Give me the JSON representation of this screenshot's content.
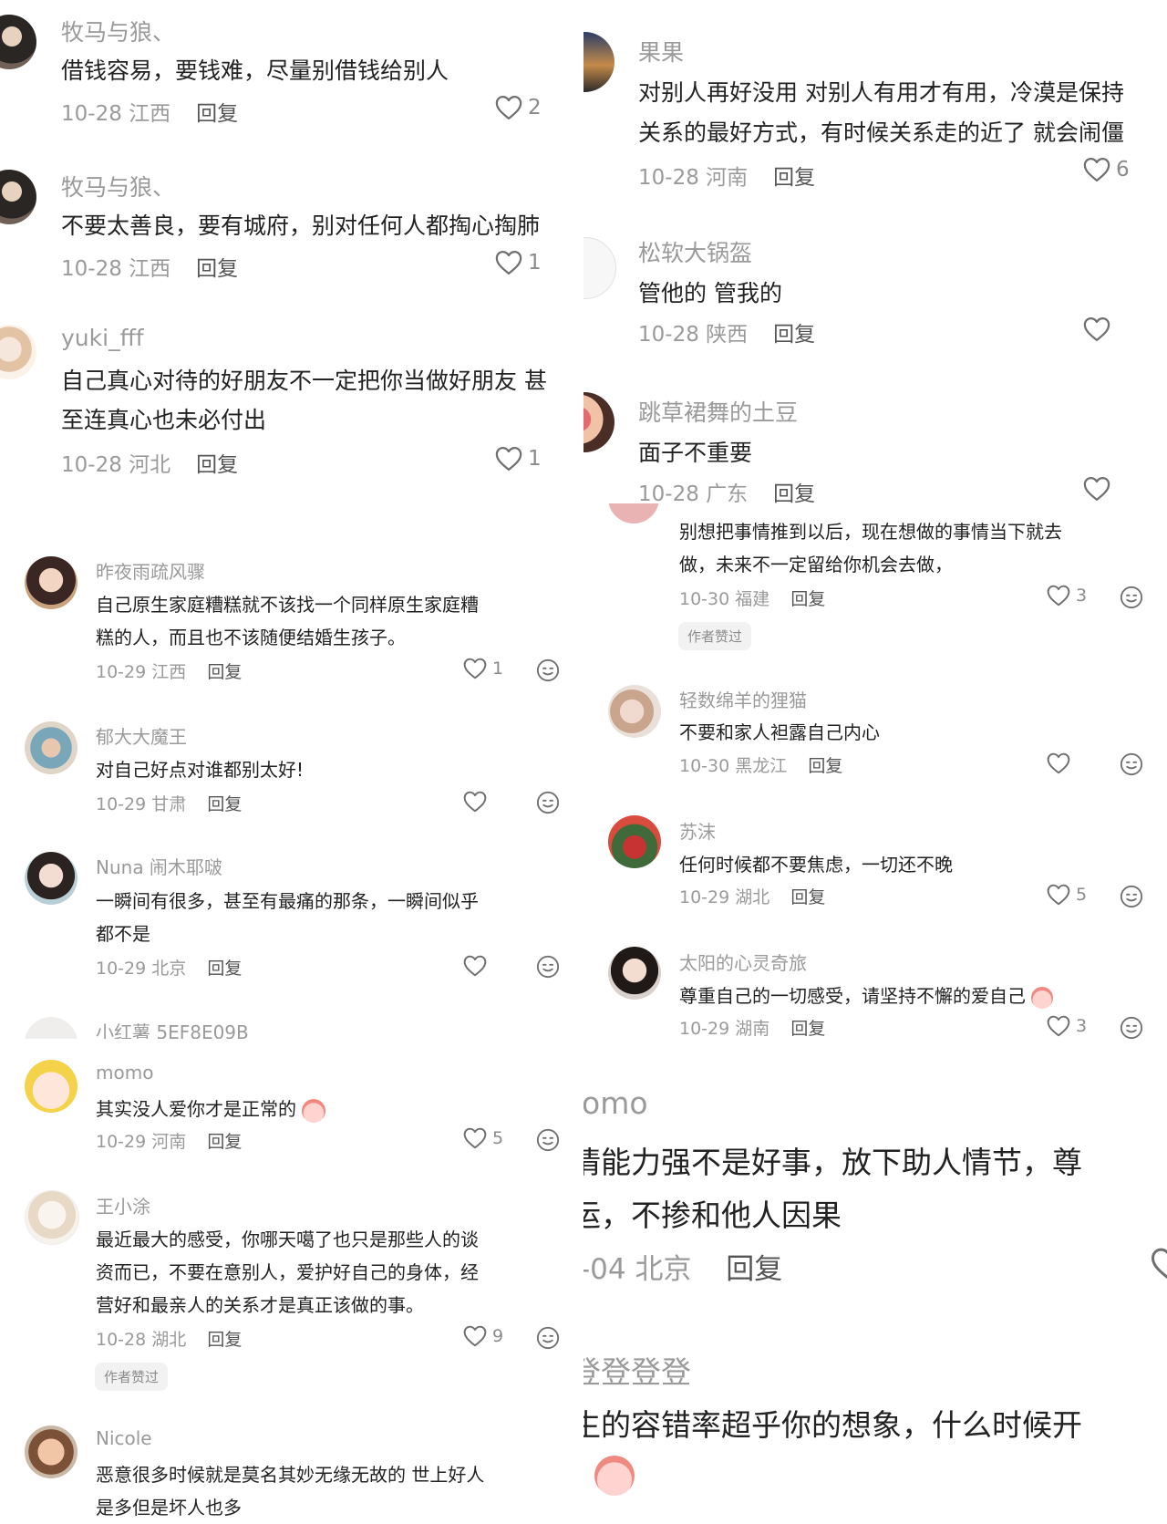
{
  "top_left": {
    "comments": [
      {
        "user": "牧马与狼、",
        "text": "借钱容易，要钱难，尽量别借钱给别人",
        "date": "10-28",
        "location": "江西",
        "reply": "回复",
        "likes": "2"
      },
      {
        "user": "牧马与狼、",
        "text": "不要太善良，要有城府，别对任何人都掏心掏肺",
        "date": "10-28",
        "location": "江西",
        "reply": "回复",
        "likes": "1"
      },
      {
        "user": "yuki_fff",
        "text_line1": "自己真心对待的好朋友不一定把你当做好朋友 甚",
        "text_line2": "至连真心也未必付出",
        "date": "10-28",
        "location": "河北",
        "reply": "回复",
        "likes": "1"
      }
    ]
  },
  "top_right": {
    "comments": [
      {
        "user": "果果",
        "text_line1": "对别人再好没用 对别人有用才有用，冷漠是保持",
        "text_line2": "关系的最好方式，有时候关系走的近了 就会闹僵",
        "date": "10-28",
        "location": "河南",
        "reply": "回复",
        "likes": "6"
      },
      {
        "user": "松软大锅盔",
        "text": "管他的 管我的",
        "date": "10-28",
        "location": "陕西",
        "reply": "回复",
        "likes": ""
      },
      {
        "user": "跳草裙舞的土豆",
        "text": "面子不重要",
        "date": "10-28",
        "location": "广东",
        "reply": "回复",
        "likes": ""
      }
    ]
  },
  "mid_right": {
    "comments": [
      {
        "user": "",
        "text_line1": "别想把事情推到以后，现在想做的事情当下就去",
        "text_line2": "做，未来不一定留给你机会去做，",
        "date": "10-30",
        "location": "福建",
        "reply": "回复",
        "likes": "3",
        "badge": "作者赞过"
      },
      {
        "user": "轻数绵羊的狸猫",
        "text": "不要和家人袒露自己内心",
        "date": "10-30",
        "location": "黑龙江",
        "reply": "回复",
        "likes": ""
      },
      {
        "user": "苏沫",
        "text": "任何时候都不要焦虑，一切还不晚",
        "date": "10-29",
        "location": "湖北",
        "reply": "回复",
        "likes": "5"
      },
      {
        "user": "太阳的心灵奇旅",
        "text": "尊重自己的一切感受，请坚持不懈的爱自己",
        "date": "10-29",
        "location": "湖南",
        "reply": "回复",
        "likes": "3"
      }
    ]
  },
  "left": {
    "comments": [
      {
        "user": "昨夜雨疏风骤",
        "text_line1": "自己原生家庭糟糕就不该找一个同样原生家庭糟",
        "text_line2": "糕的人，而且也不该随便结婚生孩子。",
        "date": "10-29",
        "location": "江西",
        "reply": "回复",
        "likes": "1"
      },
      {
        "user": "郁大大魔王",
        "text": "对自己好点对谁都别太好!",
        "date": "10-29",
        "location": "甘肃",
        "reply": "回复",
        "likes": ""
      },
      {
        "user": "Nuna 闹木耶啵",
        "text_line1": "一瞬间有很多，甚至有最痛的那条，一瞬间似乎",
        "text_line2": "都不是",
        "date": "10-29",
        "location": "北京",
        "reply": "回复",
        "likes": ""
      },
      {
        "user": "小红薯 5EF8E09B"
      },
      {
        "user": "momo",
        "text": "其实没人爱你才是正常的",
        "date": "10-29",
        "location": "河南",
        "reply": "回复",
        "likes": "5"
      },
      {
        "user": "王小涂",
        "text_line1": "最近最大的感受，你哪天噶了也只是那些人的谈",
        "text_line2": "资而已，不要在意别人，爱护好自己的身体，经",
        "text_line3": "营好和最亲人的关系才是真正该做的事。",
        "date": "10-28",
        "location": "湖北",
        "reply": "回复",
        "likes": "9",
        "badge": "作者赞过"
      },
      {
        "user": "Nicole",
        "text_line1": "恶意很多时候就是莫名其妙无缘无故的 世上好人",
        "text_line2": "是多但是坏人也多"
      }
    ]
  },
  "zoom_right": {
    "comments": [
      {
        "user": "omo",
        "text_line1": "情能力强不是好事，放下助人情节，尊",
        "text_line2": "运，不掺和他人因果",
        "date": "-04",
        "location": "北京",
        "reply": "回复"
      },
      {
        "user": "登登登登",
        "text_line1": "生的容错率超乎你的想象，什么时候开"
      }
    ]
  },
  "icons": {
    "like": "heart-outline-icon",
    "emoji": "emoji-face-icon",
    "sticker": "crying-peach-sticker"
  },
  "colors": {
    "name": "#9a9a9a",
    "text": "#222222",
    "reply": "#555555",
    "badge_bg": "#f2f2f2"
  }
}
